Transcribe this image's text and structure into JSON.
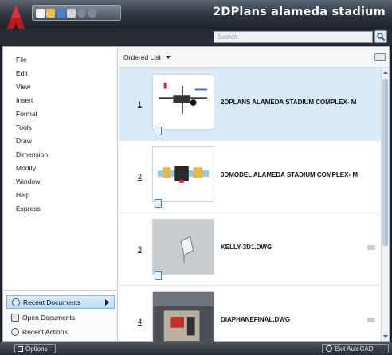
{
  "window": {
    "title": "2DPlans alameda stadium"
  },
  "search": {
    "placeholder": "Search"
  },
  "menu": {
    "items": [
      "File",
      "Edit",
      "View",
      "Insert",
      "Format",
      "Tools",
      "Draw",
      "Dimension",
      "Modify",
      "Window",
      "Help",
      "Express"
    ],
    "bottom": [
      "Recent Documents",
      "Open Documents",
      "Recent Actions"
    ]
  },
  "list": {
    "sort_label": "Ordered List",
    "documents": [
      {
        "num": "1",
        "name": "2DPLANS ALAMEDA STADIUM COMPLEX- M"
      },
      {
        "num": "2",
        "name": "3DMODEL ALAMEDA STADIUM COMPLEX- M"
      },
      {
        "num": "3",
        "name": "KELLY-3D1.DWG"
      },
      {
        "num": "4",
        "name": "DIAPHANEFINAL.DWG"
      }
    ]
  },
  "footer": {
    "options_label": "Options",
    "exit_label": "Exit AutoCAD"
  },
  "colors": {
    "accent": "#d8eaf8",
    "brand_red": "#c4161c"
  },
  "icons": [
    "application-logo-icon",
    "new-icon",
    "open-icon",
    "save-icon",
    "print-icon",
    "undo-icon",
    "redo-icon",
    "search-icon",
    "document-icon",
    "pin-icon"
  ]
}
